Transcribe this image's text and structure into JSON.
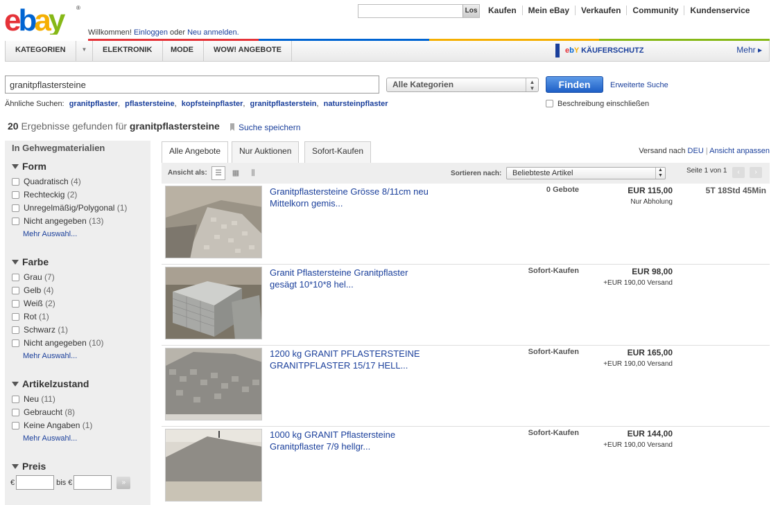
{
  "header": {
    "welcome": "Willkommen!",
    "login": "Einloggen",
    "or": "oder",
    "register": "Neu anmelden.",
    "top_search_button": "Los",
    "nav": [
      "Kaufen",
      "Mein eBay",
      "Verkaufen",
      "Community",
      "Kundenservice"
    ]
  },
  "catbar": {
    "kategorien": "KATEGORIEN",
    "items": [
      "ELEKTRONIK",
      "MODE",
      "WOW! ANGEBOTE"
    ],
    "kaeuferschutz": "KÄUFERSCHUTZ",
    "mehr": "Mehr ▸"
  },
  "search": {
    "query": "granitpflastersteine",
    "category": "Alle Kategorien",
    "button": "Finden",
    "advanced": "Erweiterte Suche",
    "similar_label": "Ähnliche Suchen:",
    "similar": [
      "granitpflaster",
      "pflastersteine",
      "kopfsteinpflaster",
      "granitpflasterstein",
      "natursteinpflaster"
    ],
    "include_desc": "Beschreibung einschließen"
  },
  "results": {
    "count": "20",
    "text": "Ergebnisse gefunden für",
    "term": "granitpflastersteine",
    "save": "Suche speichern"
  },
  "sidebar": {
    "heading": "In Gehwegmaterialien",
    "groups": [
      {
        "title": "Form",
        "items": [
          {
            "label": "Quadratisch",
            "count": "(4)"
          },
          {
            "label": "Rechteckig",
            "count": "(2)"
          },
          {
            "label": "Unregelmäßig/Polygonal",
            "count": "(1)"
          },
          {
            "label": "Nicht angegeben",
            "count": "(13)"
          }
        ],
        "more": "Mehr Auswahl..."
      },
      {
        "title": "Farbe",
        "items": [
          {
            "label": "Grau",
            "count": "(7)"
          },
          {
            "label": "Gelb",
            "count": "(4)"
          },
          {
            "label": "Weiß",
            "count": "(2)"
          },
          {
            "label": "Rot",
            "count": "(1)"
          },
          {
            "label": "Schwarz",
            "count": "(1)"
          },
          {
            "label": "Nicht angegeben",
            "count": "(10)"
          }
        ],
        "more": "Mehr Auswahl..."
      },
      {
        "title": "Artikelzustand",
        "items": [
          {
            "label": "Neu",
            "count": "(11)"
          },
          {
            "label": "Gebraucht",
            "count": "(8)"
          },
          {
            "label": "Keine Angaben",
            "count": "(1)"
          }
        ],
        "more": "Mehr Auswahl..."
      }
    ],
    "price": {
      "title": "Preis",
      "currency": "€",
      "bis": "bis €"
    }
  },
  "tabs": [
    "Alle Angebote",
    "Nur Auktionen",
    "Sofort-Kaufen"
  ],
  "shipping_to": {
    "label": "Versand nach",
    "country": "DEU",
    "customize": "Ansicht anpassen"
  },
  "listbar": {
    "view_label": "Ansicht als:",
    "sort_label": "Sortieren nach:",
    "sort_value": "Beliebteste Artikel",
    "page": "Seite 1 von 1"
  },
  "listings": [
    {
      "title": "Granitpflastersteine Grösse 8/11cm neu Mittelkorn gemis...",
      "type": "0 Gebote",
      "price": "EUR 115,00",
      "shipping": "Nur Abholung",
      "time": "5T 18Std 45Min"
    },
    {
      "title": "Granit Pflastersteine Granitpflaster gesägt 10*10*8 hel...",
      "type": "Sofort-Kaufen",
      "price": "EUR 98,00",
      "shipping": "+EUR 190,00 Versand",
      "time": ""
    },
    {
      "title": "1200 kg GRANIT PFLASTERSTEINE GRANITPFLASTER 15/17 HELL...",
      "type": "Sofort-Kaufen",
      "price": "EUR 165,00",
      "shipping": "+EUR 190,00 Versand",
      "time": ""
    },
    {
      "title": "1000 kg GRANIT Pflastersteine Granitpflaster 7/9 hellgr...",
      "type": "Sofort-Kaufen",
      "price": "EUR 144,00",
      "shipping": "+EUR 190,00 Versand",
      "time": ""
    }
  ],
  "colors": {
    "ebay_red": "#e53238",
    "ebay_blue": "#0064d2",
    "ebay_yellow": "#f5af02",
    "ebay_green": "#86b817",
    "link": "#1a3f9b"
  }
}
